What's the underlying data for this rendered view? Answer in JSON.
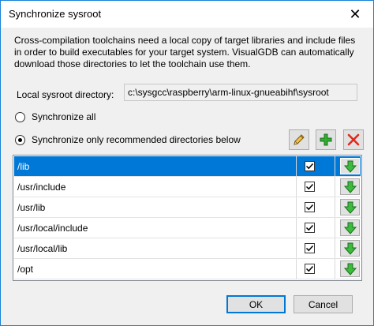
{
  "window": {
    "title": "Synchronize sysroot",
    "close_glyph": "✕"
  },
  "description": "Cross-compilation toolchains need a local copy of target libraries and include files in order to build executables for your target system. VisualGDB can automatically download those directories to let the toolchain use them.",
  "sysroot": {
    "label": "Local sysroot directory:",
    "value": "c:\\sysgcc\\raspberry\\arm-linux-gnueabihf\\sysroot"
  },
  "sync_options": {
    "all_label": "Synchronize all",
    "recommended_label": "Synchronize only recommended directories below",
    "selected": "recommended"
  },
  "toolbar": {
    "edit_icon": "pencil-icon",
    "add_icon": "plus-icon",
    "remove_icon": "x-icon"
  },
  "directories": [
    {
      "path": "/lib",
      "checked": true,
      "selected": true
    },
    {
      "path": "/usr/include",
      "checked": true,
      "selected": false
    },
    {
      "path": "/usr/lib",
      "checked": true,
      "selected": false
    },
    {
      "path": "/usr/local/include",
      "checked": true,
      "selected": false
    },
    {
      "path": "/usr/local/lib",
      "checked": true,
      "selected": false
    },
    {
      "path": "/opt",
      "checked": true,
      "selected": false
    }
  ],
  "buttons": {
    "ok": "OK",
    "cancel": "Cancel"
  },
  "colors": {
    "accent": "#0078d7",
    "border": "#1883d7",
    "green": "#2fae2f",
    "red": "#e02a1d"
  }
}
